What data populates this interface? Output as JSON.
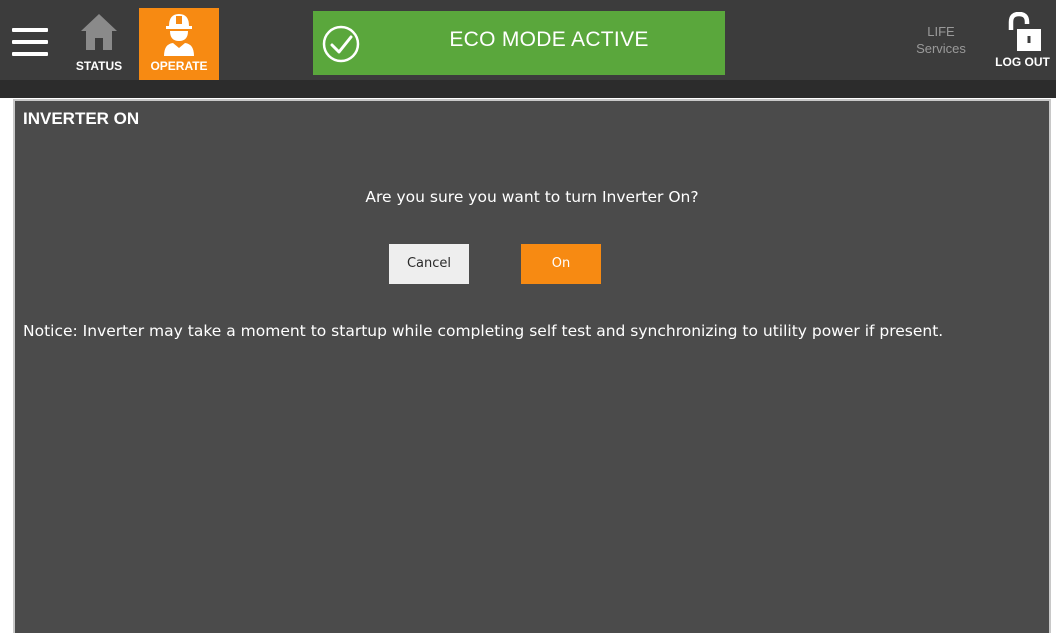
{
  "header": {
    "menu_icon": "hamburger-menu-icon",
    "tabs": [
      {
        "label": "STATUS",
        "icon": "home-icon",
        "active": false
      },
      {
        "label": "OPERATE",
        "icon": "operator-hardhat-icon",
        "active": true
      }
    ],
    "eco_banner": {
      "label": "ECO MODE ACTIVE",
      "icon": "check-circle-icon",
      "color": "#5aa73c"
    },
    "life_services": {
      "line1": "LIFE",
      "line2": "Services"
    },
    "logout": {
      "label": "LOG OUT",
      "icon": "unlocked-padlock-icon"
    }
  },
  "dialog": {
    "title": "INVERTER ON",
    "prompt": "Are you sure you want to turn Inverter On?",
    "cancel_label": "Cancel",
    "confirm_label": "On",
    "notice": "Notice: Inverter may take a moment to startup while completing self test and synchronizing to utility power if present."
  },
  "colors": {
    "accent": "#f78a12",
    "topbar": "#3c3c3c",
    "panel": "#4b4b4b",
    "eco_green": "#5aa73c"
  }
}
